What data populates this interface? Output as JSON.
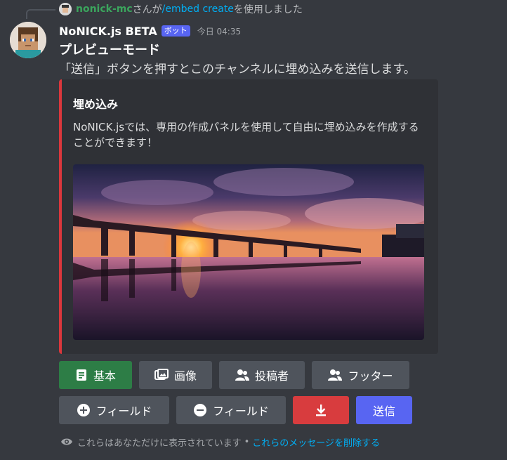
{
  "reply": {
    "user": "nonick-mc",
    "text_mid": "さんが",
    "command": "/embed create",
    "text_end": "を使用しました"
  },
  "message": {
    "author": "NoNICK.js BETA",
    "bot_tag": "ボット",
    "timestamp": "今日 04:35",
    "title": "プレビューモード",
    "body": "「送信」ボタンを押すとこのチャンネルに埋め込みを送信します。"
  },
  "embed": {
    "accent_color": "#da373c",
    "title": "埋め込み",
    "description": "NoNICK.jsでは、専用の作成パネルを使用して自由に埋め込みを作成することができます！"
  },
  "buttons_row1": [
    {
      "label": "基本",
      "icon": "document-icon",
      "style": "success"
    },
    {
      "label": "画像",
      "icon": "image-icon",
      "style": "secondary"
    },
    {
      "label": "投稿者",
      "icon": "people-icon",
      "style": "secondary"
    },
    {
      "label": "フッター",
      "icon": "people-icon",
      "style": "secondary"
    }
  ],
  "buttons_row2": [
    {
      "label": "フィールド",
      "icon": "plus-circle-icon",
      "style": "secondary"
    },
    {
      "label": "フィールド",
      "icon": "minus-circle-icon",
      "style": "secondary"
    },
    {
      "label": "",
      "icon": "download-icon",
      "style": "danger"
    },
    {
      "label": "送信",
      "icon": "",
      "style": "primary"
    }
  ],
  "footer": {
    "text": "これらはあなただけに表示されています",
    "separator": "•",
    "link": "これらのメッセージを削除する"
  }
}
